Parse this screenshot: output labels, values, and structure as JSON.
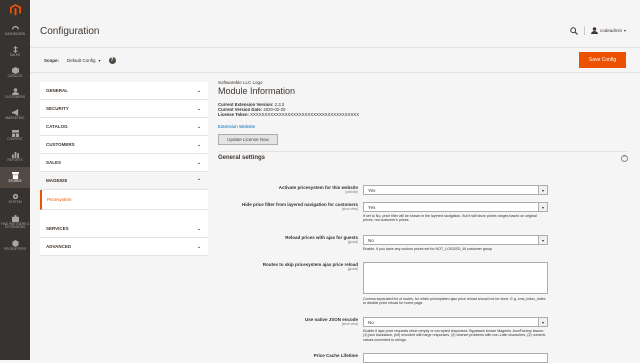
{
  "nav": {
    "items": [
      {
        "label": "DASHBOARD",
        "icon": "dashboard-icon"
      },
      {
        "label": "SALES",
        "icon": "dollar-icon"
      },
      {
        "label": "CATALOG",
        "icon": "cube-icon"
      },
      {
        "label": "CUSTOMERS",
        "icon": "person-icon"
      },
      {
        "label": "MARKETING",
        "icon": "megaphone-icon"
      },
      {
        "label": "CONTENT",
        "icon": "layout-icon"
      },
      {
        "label": "REPORTS",
        "icon": "bar-chart-icon"
      },
      {
        "label": "STORES",
        "icon": "store-icon"
      },
      {
        "label": "SYSTEM",
        "icon": "gear-icon"
      },
      {
        "label": "FIND PARTNERS & EXTENSIONS",
        "icon": "puzzle-icon"
      },
      {
        "label": "PROSOFTERS",
        "icon": "hexagon-icon"
      }
    ]
  },
  "header": {
    "title": "Configuration",
    "username": "codeadmin"
  },
  "actions": {
    "save_label": "Save Config"
  },
  "scope": {
    "label": "Scope:",
    "value": "Default Config",
    "help": "?"
  },
  "tabs": {
    "general": "GENERAL",
    "security": "SECURITY",
    "catalog": "CATALOG",
    "customers": "CUSTOMERS",
    "sales": "SALES",
    "mage928": "MAGE928",
    "pricesystem": "Pricesystem",
    "services": "SERVICES",
    "advanced": "ADVANCED"
  },
  "module": {
    "vendor": "Softwareble LLC Logo",
    "title": "Module Information",
    "version_label": "Current Extension Version:",
    "version": "2.3.3",
    "date_label": "Current Version Date:",
    "date": "2020-02-20",
    "license_label": "License Token:",
    "license": "XXXXXXXXXXXXXXXXXXXXXXXXXXXXXXXXXXXXXX",
    "ext_link": "Extension Website",
    "update_btn": "Update License Now"
  },
  "settings": {
    "heading": "General settings",
    "f1": {
      "label": "Activate pricesystem for this website",
      "scope": "[website]",
      "value": "Yes"
    },
    "f2": {
      "label": "Hide price filter from layered navigation for customers",
      "scope": "[store view]",
      "value": "Yes",
      "note": "If set to No, price filter will be shown in the layered navigation. But it will show prices ranges based on original prices, not customer's prices."
    },
    "f3": {
      "label": "Reload prices with ajax for guests",
      "scope": "[global]",
      "value": "No",
      "note": "Enable, if you have any custom prices set for NOT_LOGGED_IN customer group"
    },
    "f4": {
      "label": "Routes to skip pricesystem ajax price reload",
      "scope": "[global]",
      "note": "Comma separated list of routes, for which pricesystem ajax price reload should not be done. E.g. cms_index_index to disable price reload for home page."
    },
    "f5": {
      "label": "Use native JSON encode",
      "scope": "[store view]",
      "value": "No",
      "note": "Enable if ajax price requests return empty or corrupted responses. Bypasses known Magento JsonFactory issues: (1) json backslash, (Int) encoded with large responses, (2) charset problems with non-Latin characters, (3) numeric values converted to strings."
    },
    "f6": {
      "label": "Price Cache Lifetime"
    }
  }
}
